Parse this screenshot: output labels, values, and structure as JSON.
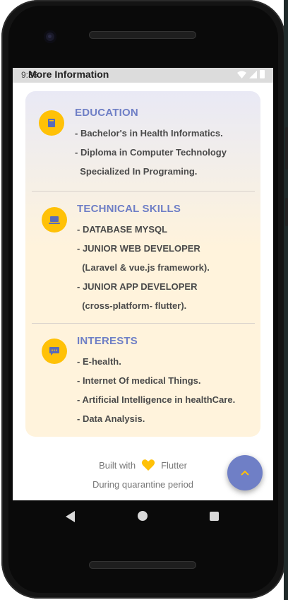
{
  "status_bar": {
    "time": "9:36",
    "title": "More Information"
  },
  "sections": [
    {
      "id": "education",
      "title": "EDUCATION",
      "icon": "book-icon",
      "lines": [
        "- Bachelor's in Health Informatics.",
        "- Diploma in Computer Technology",
        "  Specialized In Programing."
      ]
    },
    {
      "id": "technical-skills",
      "title": "TECHNICAL SKILLS",
      "icon": "laptop-icon",
      "lines": [
        "- DATABASE MYSQL",
        "- JUNIOR WEB DEVELOPER",
        "  (Laravel & vue.js framework).",
        "- JUNIOR APP DEVELOPER",
        "  (cross-platform- flutter)."
      ]
    },
    {
      "id": "interests",
      "title": "INTERESTS",
      "icon": "chat-bubble-icon",
      "lines": [
        "- E-health.",
        "- Internet Of medical Things.",
        "- Artificial Intelligence in healthCare.",
        "- Data Analysis."
      ]
    }
  ],
  "footer": {
    "built_with": "Built with",
    "framework": "Flutter",
    "note": "During quarantine period"
  },
  "colors": {
    "accent": "#6f7fc6",
    "icon_bg": "#ffc107",
    "heart": "#ffc107"
  }
}
